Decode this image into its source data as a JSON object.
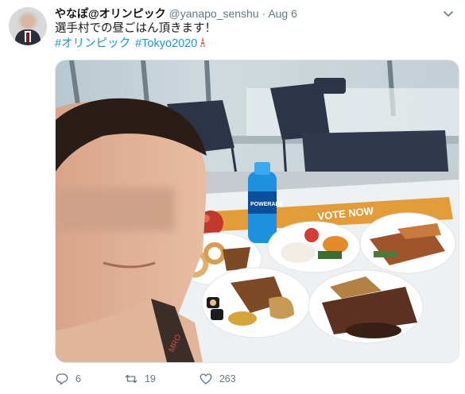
{
  "tweet": {
    "display_name": "やなぽ@オリンピック",
    "handle": "@yanapo_senshu",
    "separator": "·",
    "date": "Aug 6",
    "text": "選手村での昼ごはん頂きます！",
    "hashtags": [
      "#オリンピック",
      "#Tokyo2020"
    ]
  },
  "media": {
    "banner_text": "VOTE NOW",
    "bottle_brand": "POWERADE",
    "lanyard_text": "MRO"
  },
  "actions": {
    "reply_count": "6",
    "retweet_count": "19",
    "like_count": "263"
  },
  "icons": {
    "reply": "reply-icon",
    "retweet": "retweet-icon",
    "like": "heart-icon",
    "more": "chevron-down-icon",
    "tower": "tokyo-tower-icon"
  },
  "colors": {
    "link": "#1b95e0",
    "secondary": "#657786",
    "primary_text": "#14171a"
  }
}
